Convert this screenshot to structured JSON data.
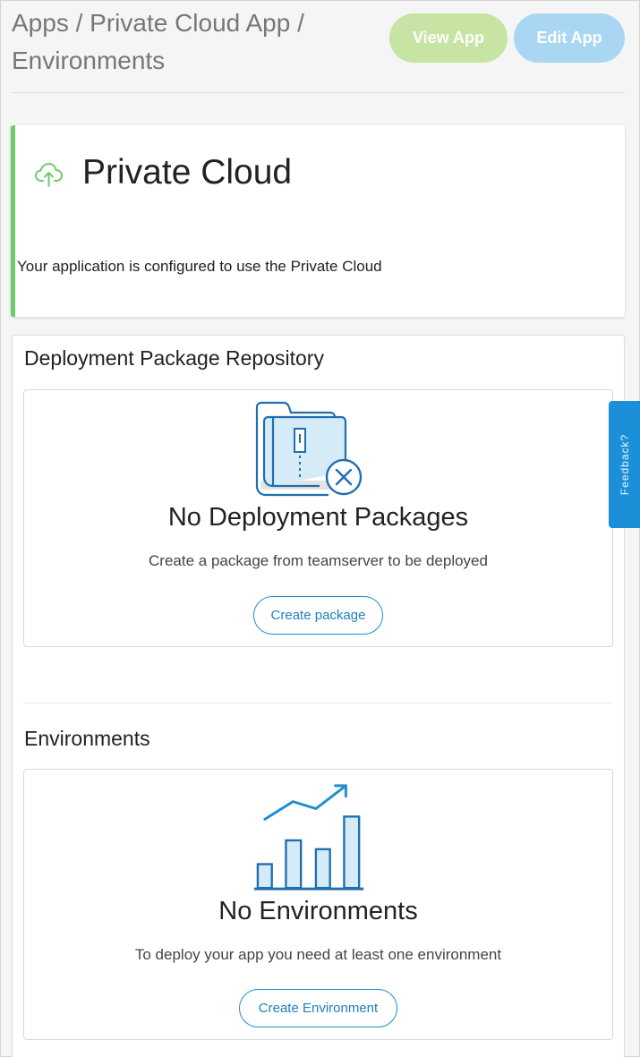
{
  "header": {
    "breadcrumb": "Apps / Private Cloud App / Environments",
    "view_app_label": "View App",
    "edit_app_label": "Edit App"
  },
  "cloud_card": {
    "title": "Private Cloud",
    "description": "Your application is configured to use the Private Cloud",
    "icon": "cloud-upload-icon",
    "accent_color": "#72c96c"
  },
  "repository": {
    "heading": "Deployment Package Repository",
    "empty_title": "No Deployment Packages",
    "empty_description": "Create a package from teamserver to be deployed",
    "button_label": "Create package",
    "icon": "zip-folder-remove-icon"
  },
  "environments": {
    "heading": "Environments",
    "empty_title": "No Environments",
    "empty_description": "To deploy your app you need at least one environment",
    "button_label": "Create Environment",
    "icon": "growth-chart-icon"
  },
  "feedback": {
    "label": "Feedback?"
  },
  "colors": {
    "view_app": "#c7e4a4",
    "edit_app": "#a9d6f2",
    "primary": "#1f8dd0",
    "feedback": "#1b8fd8"
  }
}
